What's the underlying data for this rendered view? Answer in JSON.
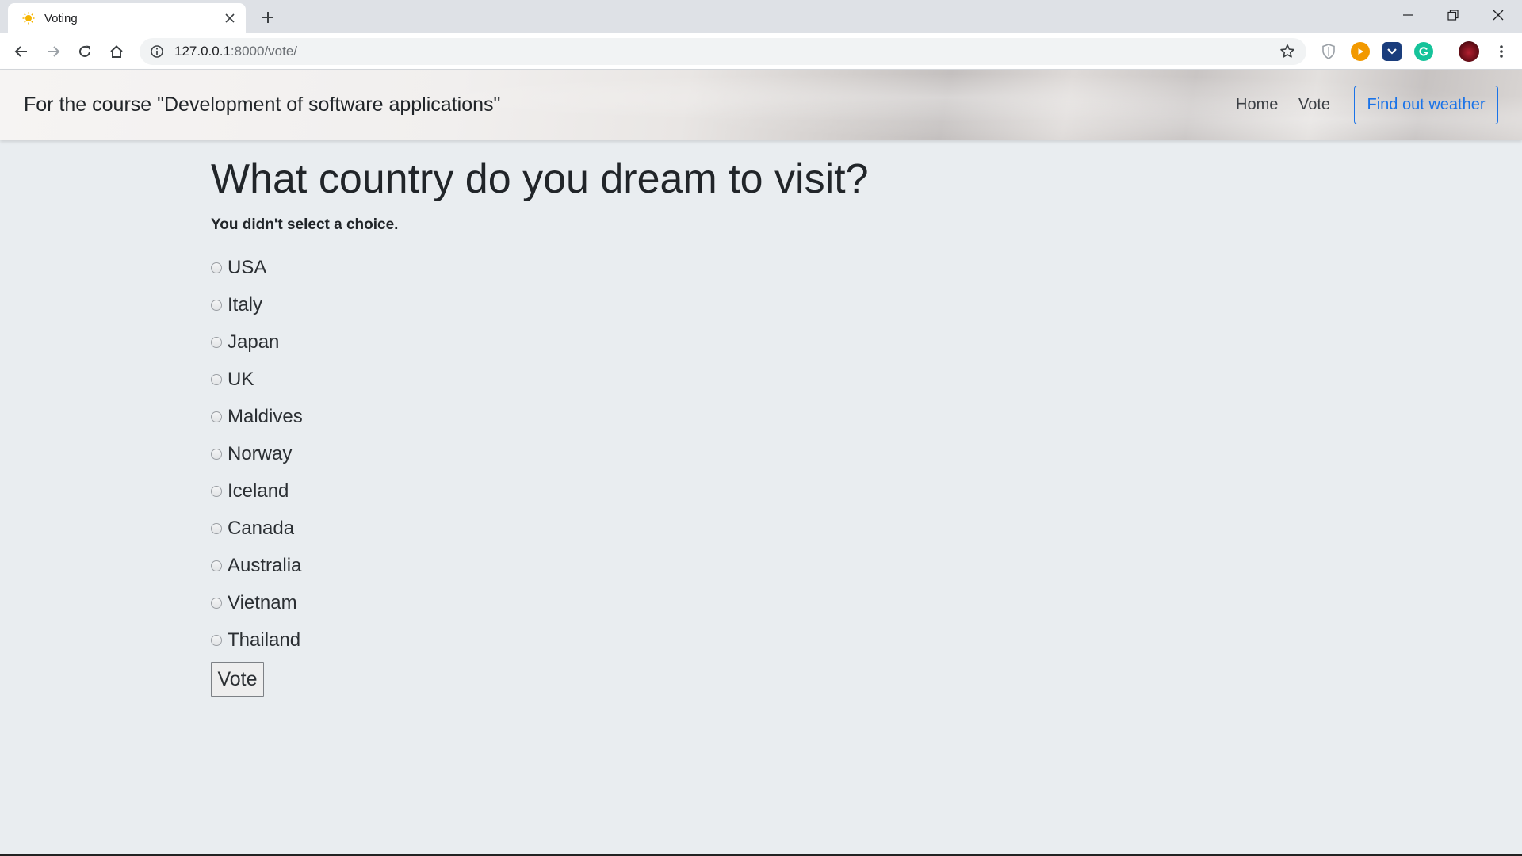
{
  "browser": {
    "tab_title": "Voting",
    "url_host": "127.0.0.1",
    "url_rest": ":8000/vote/"
  },
  "navbar": {
    "brand": "For the course \"Development of software applications\"",
    "links": [
      "Home",
      "Vote"
    ],
    "weather_button": "Find out weather"
  },
  "poll": {
    "question": "What country do you dream to visit?",
    "error": "You didn't select a choice.",
    "choices": [
      "USA",
      "Italy",
      "Japan",
      "UK",
      "Maldives",
      "Norway",
      "Iceland",
      "Canada",
      "Australia",
      "Vietnam",
      "Thailand"
    ],
    "submit_label": "Vote"
  }
}
